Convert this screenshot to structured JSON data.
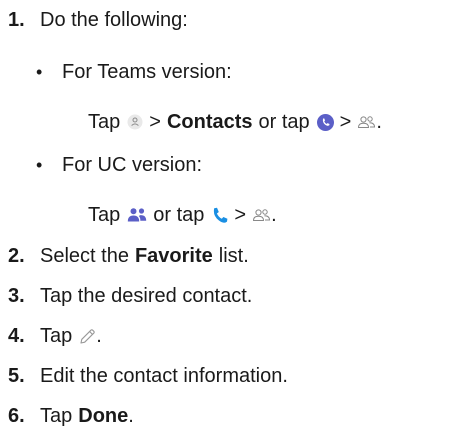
{
  "step1": {
    "number": "1.",
    "text": "Do the following:",
    "bullet_teams": {
      "marker": "•",
      "label": "For Teams version:",
      "tap": "Tap",
      "sep1": ">",
      "contacts": "Contacts",
      "or_tap": "or tap",
      "sep2": ">",
      "end": "."
    },
    "bullet_uc": {
      "marker": "•",
      "label": "For UC version:",
      "tap": "Tap",
      "or_tap": "or tap",
      "sep": ">",
      "end": "."
    }
  },
  "step2": {
    "number": "2.",
    "pre": "Select the",
    "bold": "Favorite",
    "post": "list."
  },
  "step3": {
    "number": "3.",
    "text": "Tap the desired contact."
  },
  "step4": {
    "number": "4.",
    "tap": "Tap",
    "end": "."
  },
  "step5": {
    "number": "5.",
    "text": "Edit the contact information."
  },
  "step6": {
    "number": "6.",
    "tap": "Tap",
    "bold": "Done",
    "end": "."
  },
  "icons": {
    "avatar": "avatar-icon",
    "teams_calls": "teams-calls-icon",
    "contacts_group": "contacts-group-icon",
    "uc_people": "people-icon",
    "uc_phone": "phone-icon",
    "edit": "pencil-icon"
  },
  "colors": {
    "text": "#1a1a1a",
    "teams_purple": "#5b5fc7",
    "uc_blue": "#1a8fe3",
    "icon_grey": "#888888"
  }
}
